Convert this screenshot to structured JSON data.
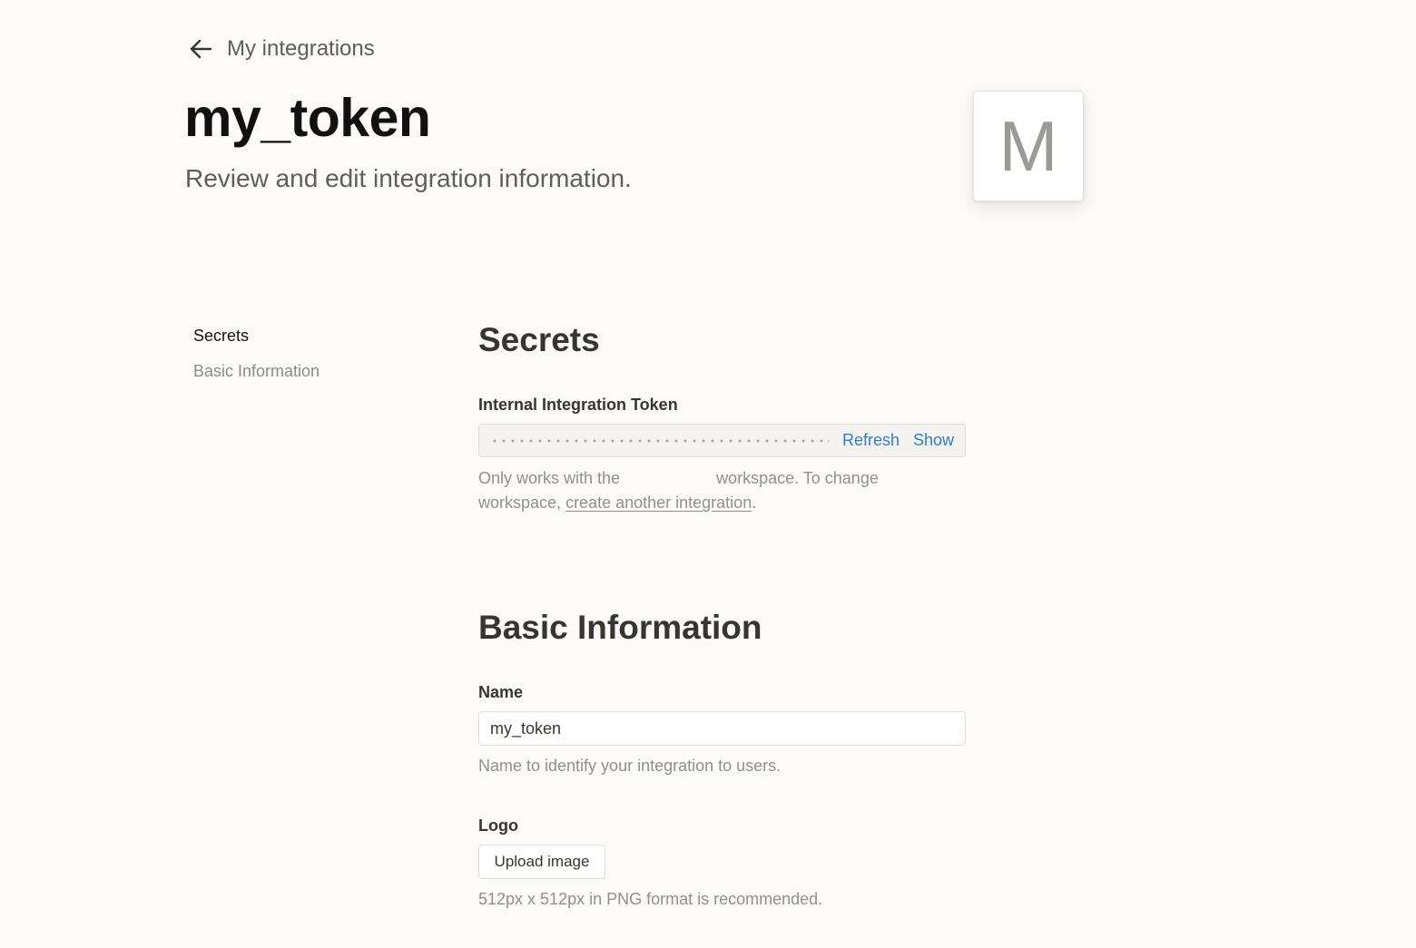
{
  "header": {
    "back_label": "My integrations",
    "title": "my_token",
    "subtitle": "Review and edit integration information.",
    "avatar_letter": "M"
  },
  "sidebar": {
    "items": [
      {
        "label": "Secrets",
        "active": true
      },
      {
        "label": "Basic Information",
        "active": false
      }
    ]
  },
  "secrets": {
    "heading": "Secrets",
    "token_label": "Internal Integration Token",
    "refresh_label": "Refresh",
    "show_label": "Show",
    "helper_prefix": "Only works with the",
    "helper_middle": "workspace. To change",
    "helper_line2_prefix": "workspace,",
    "helper_link": "create another integration",
    "helper_suffix": "."
  },
  "basic_info": {
    "heading": "Basic Information",
    "name_label": "Name",
    "name_value": "my_token",
    "name_helper": "Name to identify your integration to users.",
    "logo_label": "Logo",
    "upload_label": "Upload image",
    "logo_helper": "512px x 512px in PNG format is recommended."
  },
  "colors": {
    "background": "#fcfbfa",
    "link": "#2f7cd3",
    "text": "#37352f",
    "muted": "#91908d"
  },
  "icons": {
    "back": "arrow-left-icon"
  }
}
